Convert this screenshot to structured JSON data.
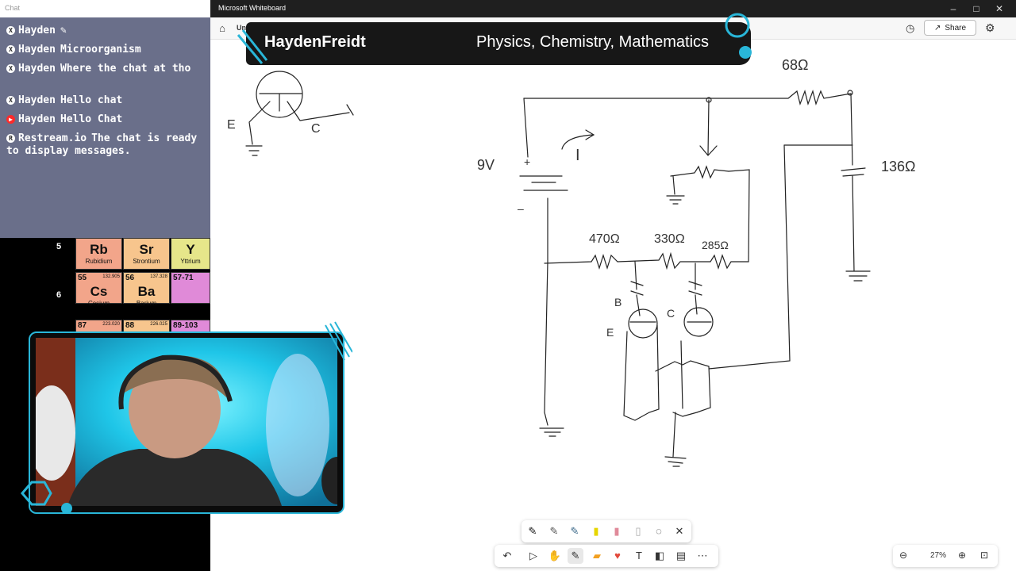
{
  "window": {
    "title": "Microsoft Whiteboard",
    "doc_title": "Unti",
    "share_label": "Share",
    "controls": [
      "–",
      "□",
      "✕"
    ]
  },
  "banner": {
    "name": "HaydenFreidt",
    "subjects": "Physics, Chemistry, Mathematics"
  },
  "chat": {
    "header": "Chat",
    "messages": [
      {
        "platform": "X",
        "author": "Hayden",
        "text": "✎"
      },
      {
        "platform": "X",
        "author": "Hayden",
        "text": "Microorganism"
      },
      {
        "platform": "X",
        "author": "Hayden",
        "text": "Where the chat at tho"
      },
      {
        "platform": "X",
        "author": "Hayden",
        "text": "Hello chat"
      },
      {
        "platform": "YT",
        "author": "Hayden",
        "text": "Hello Chat"
      },
      {
        "platform": "R",
        "author": "Restream.io",
        "text": "The chat is ready to display messages."
      }
    ]
  },
  "periodic": {
    "rows": [
      {
        "period": "5",
        "cells": [
          {
            "sym": "Rb",
            "name": "Rubidium",
            "num": "",
            "mass": "",
            "color": "#f2a58a"
          },
          {
            "sym": "Sr",
            "name": "Strontium",
            "num": "",
            "mass": "",
            "color": "#f7c58d"
          },
          {
            "sym": "Y",
            "name": "Yttrium",
            "num": "",
            "mass": "",
            "color": "#e6e68a"
          }
        ]
      },
      {
        "period": "6",
        "cells": [
          {
            "sym": "Cs",
            "name": "Cesium",
            "num": "55",
            "mass": "132.905",
            "color": "#f2a58a"
          },
          {
            "sym": "Ba",
            "name": "Barium",
            "num": "56",
            "mass": "137.328",
            "color": "#f7c58d"
          },
          {
            "sym": "",
            "name": "",
            "num": "57-71",
            "mass": "",
            "color": "#e08ad8"
          }
        ]
      },
      {
        "period": "",
        "cells": [
          {
            "sym": "",
            "name": "",
            "num": "87",
            "mass": "223.020",
            "color": "#f2a58a"
          },
          {
            "sym": "",
            "name": "",
            "num": "88",
            "mass": "226.025",
            "color": "#f7c58d"
          },
          {
            "sym": "",
            "name": "",
            "num": "89-103",
            "mass": "",
            "color": "#e08ad8"
          }
        ]
      }
    ]
  },
  "whiteboard": {
    "labels": {
      "r1": "68Ω",
      "r2": "136Ω",
      "r3": "470Ω",
      "r4": "330Ω",
      "r5": "285Ω",
      "battery": "9V",
      "current": "I",
      "b": "B",
      "c": "C",
      "e": "E",
      "c2": "C",
      "e2": "E"
    }
  },
  "zoom": {
    "level": "27%"
  },
  "colors": {
    "accent": "#29b6d8",
    "banner_bg": "#171717",
    "chat_bg": "#6a6f8a"
  }
}
